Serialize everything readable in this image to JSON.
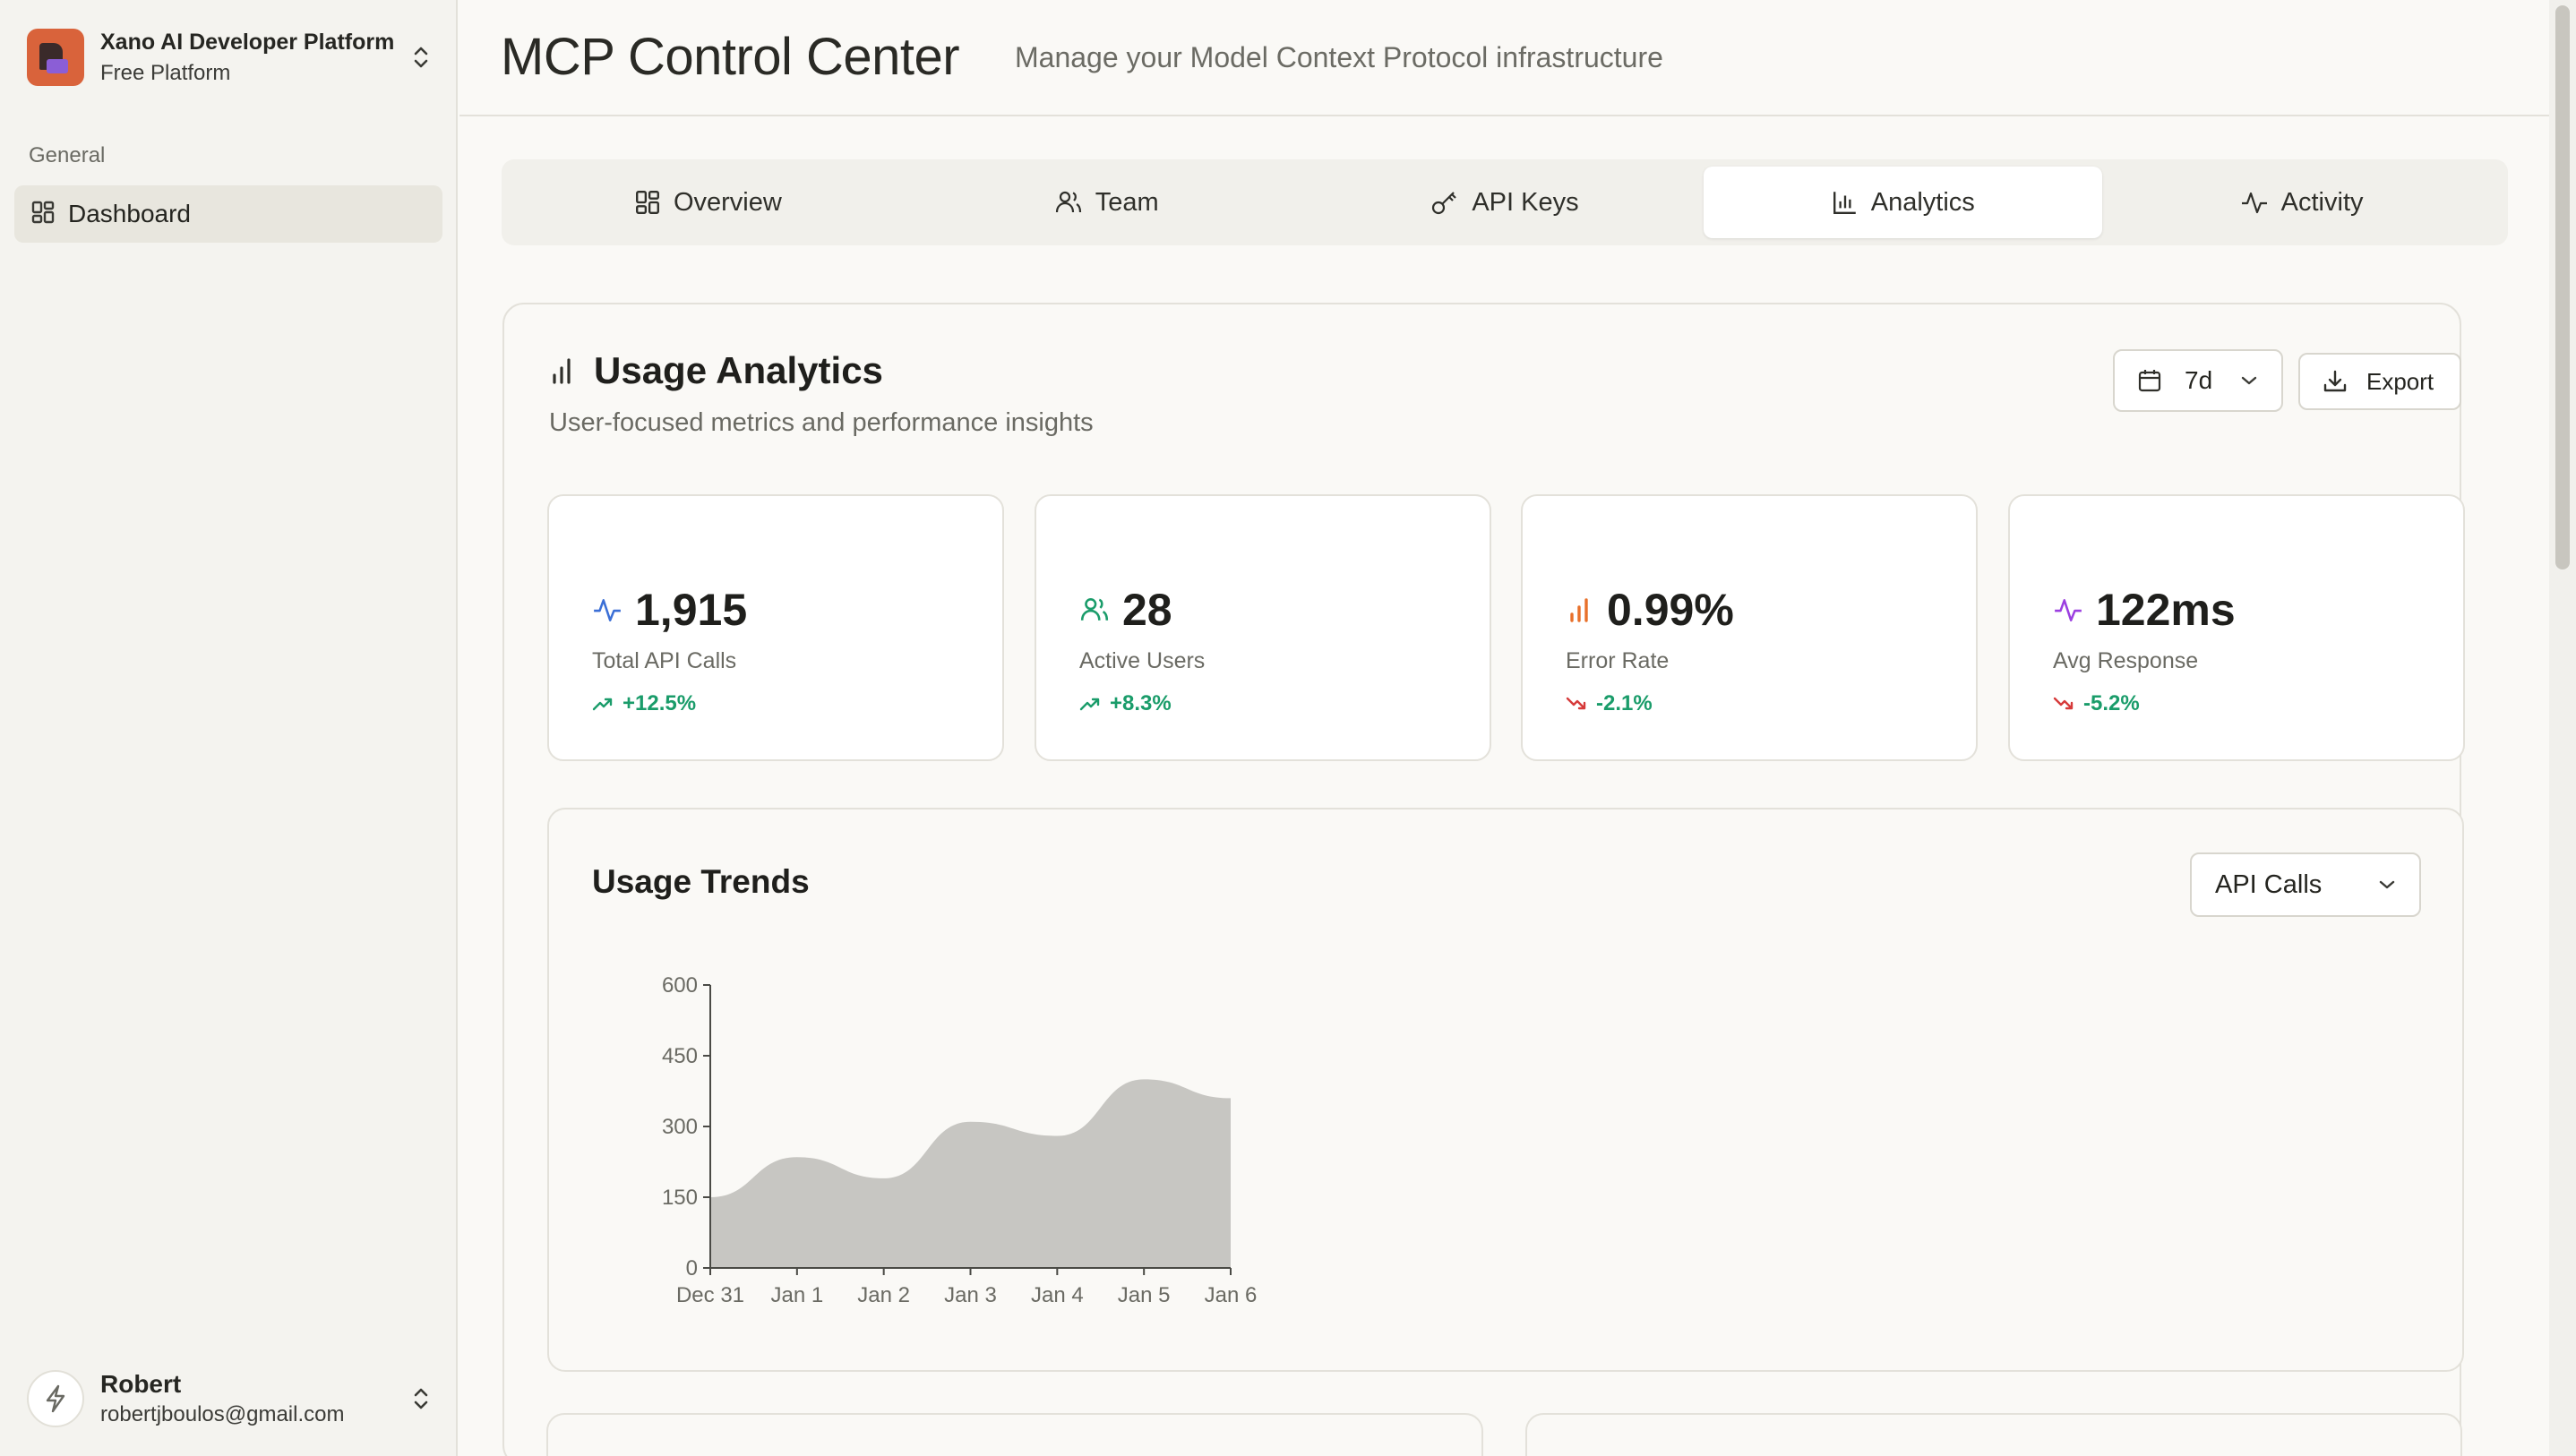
{
  "workspace": {
    "name": "Xano AI Developer Platform",
    "plan": "Free Platform"
  },
  "sidebar": {
    "section_label": "General",
    "items": [
      {
        "label": "Dashboard",
        "icon": "dashboard-icon"
      }
    ]
  },
  "user": {
    "name": "Robert",
    "email": "robertjboulos@gmail.com"
  },
  "header": {
    "title": "MCP Control Center",
    "subtitle": "Manage your Model Context Protocol infrastructure"
  },
  "tabs": [
    {
      "label": "Overview",
      "icon": "grid-icon",
      "active": false
    },
    {
      "label": "Team",
      "icon": "users-icon",
      "active": false
    },
    {
      "label": "API Keys",
      "icon": "key-icon",
      "active": false
    },
    {
      "label": "Analytics",
      "icon": "bar-chart-icon",
      "active": true
    },
    {
      "label": "Activity",
      "icon": "activity-icon",
      "active": false
    }
  ],
  "analytics": {
    "title": "Usage Analytics",
    "description": "User-focused metrics and performance insights",
    "range": "7d",
    "export_label": "Export"
  },
  "stats": [
    {
      "value": "1,915",
      "label": "Total API Calls",
      "change": "+12.5%",
      "icon": "activity-icon",
      "color": "#3b6fd6",
      "trend": "up"
    },
    {
      "value": "28",
      "label": "Active Users",
      "change": "+8.3%",
      "icon": "users-icon",
      "color": "#1a9c6a",
      "trend": "up"
    },
    {
      "value": "0.99%",
      "label": "Error Rate",
      "change": "-2.1%",
      "icon": "bar-chart-icon",
      "color": "#e8702a",
      "trend": "down"
    },
    {
      "value": "122ms",
      "label": "Avg Response",
      "change": "-5.2%",
      "icon": "activity-icon",
      "color": "#9b3fe0",
      "trend": "down"
    }
  ],
  "colors": {
    "positive": "#1a9c6a",
    "negative": "#d63a3a",
    "area_fill": "#c7c6c2"
  },
  "trends": {
    "title": "Usage Trends",
    "metric": "API Calls"
  },
  "chart_data": {
    "type": "area",
    "title": "Usage Trends",
    "categories": [
      "Dec 31",
      "Jan 1",
      "Jan 2",
      "Jan 3",
      "Jan 4",
      "Jan 5",
      "Jan 6"
    ],
    "values": [
      150,
      235,
      190,
      310,
      280,
      400,
      360
    ],
    "ylim": [
      0,
      600
    ],
    "yticks": [
      0,
      150,
      300,
      450,
      600
    ],
    "grid": false,
    "legend": "none"
  }
}
